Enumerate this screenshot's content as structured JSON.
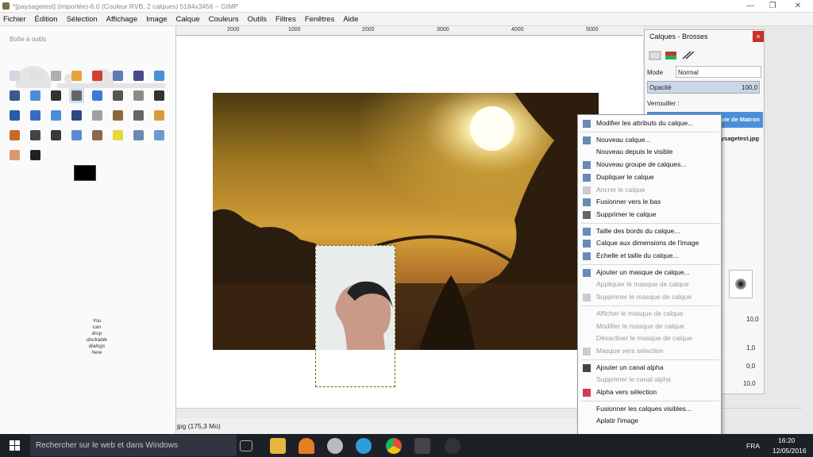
{
  "window": {
    "title": "*[paysagetest] (importée)-6.0 (Couleur RVB, 2 calques) 5184x3456 – GIMP",
    "controls": [
      "—",
      "❐",
      "✕"
    ]
  },
  "menubar": [
    "Fichier",
    "Édition",
    "Sélection",
    "Affichage",
    "Image",
    "Calque",
    "Couleurs",
    "Outils",
    "Filtres",
    "Fenêtres",
    "Aide"
  ],
  "toolbox": {
    "title": "Boîte à outils",
    "drop_hint": [
      "You",
      "can",
      "drop",
      "dockable",
      "dialogs",
      "here"
    ]
  },
  "ruler": {
    "labels": [
      "2000",
      "1000",
      "2000",
      "3000",
      "4000",
      "5000"
    ]
  },
  "status": {
    "text": "jpg (175,3 Mo)"
  },
  "dock": {
    "title": "Calques - Brosses",
    "close": "×",
    "mode_label": "Mode",
    "mode_value": "Normal",
    "opacity_label": "Opacité",
    "opacity_value": "100,0",
    "lock_label": "Verrouiller :",
    "layer1": "pie de Matron",
    "layer2": "ysagetest.jpg",
    "spin_values": [
      "10,0",
      "1,0",
      "0,0",
      "10,0"
    ]
  },
  "context_menu": {
    "items": [
      {
        "label": "Modifier les attributs du calque...",
        "disabled": false,
        "icon": "edit-icon"
      },
      {
        "sep": true
      },
      {
        "label": "Nouveau calque...",
        "disabled": false,
        "icon": "new-layer-icon"
      },
      {
        "label": "Nouveau depuis le visible",
        "disabled": false,
        "icon": ""
      },
      {
        "label": "Nouveau groupe de calques...",
        "disabled": false,
        "icon": "folder-icon"
      },
      {
        "label": "Dupliquer le calque",
        "disabled": false,
        "icon": "duplicate-icon"
      },
      {
        "label": "Ancrer le calque",
        "disabled": true,
        "icon": "anchor-icon"
      },
      {
        "label": "Fusionner vers le bas",
        "disabled": false,
        "icon": "merge-down-icon"
      },
      {
        "label": "Supprimer le calque",
        "disabled": false,
        "icon": "trash-icon"
      },
      {
        "sep": true
      },
      {
        "label": "Taille des bords du calque...",
        "disabled": false,
        "icon": "boundary-icon"
      },
      {
        "label": "Calque aux dimensions de l'image",
        "disabled": false,
        "icon": "fit-icon"
      },
      {
        "label": "Échelle et taille du calque...",
        "disabled": false,
        "icon": "scale-icon"
      },
      {
        "sep": true
      },
      {
        "label": "Ajouter un masque de calque...",
        "disabled": false,
        "icon": "mask-add-icon"
      },
      {
        "label": "Appliquer le masque de calque",
        "disabled": true,
        "icon": ""
      },
      {
        "label": "Supprimer le masque de calque",
        "disabled": true,
        "icon": "trash-icon"
      },
      {
        "sep": true
      },
      {
        "label": "Afficher le masque de calque",
        "disabled": true,
        "icon": ""
      },
      {
        "label": "Modifier le masque de calque",
        "disabled": true,
        "icon": ""
      },
      {
        "label": "Désactiver le masque de calque",
        "disabled": true,
        "icon": ""
      },
      {
        "label": "Masque vers sélection",
        "disabled": true,
        "icon": "mask-select-icon"
      },
      {
        "sep": true
      },
      {
        "label": "Ajouter un canal alpha",
        "disabled": false,
        "icon": "alpha-icon"
      },
      {
        "label": "Supprimer le canal alpha",
        "disabled": true,
        "icon": ""
      },
      {
        "label": "Alpha vers sélection",
        "disabled": false,
        "icon": "alpha-select-icon"
      },
      {
        "sep": true
      },
      {
        "label": "Fusionner les calques visibles...",
        "disabled": false,
        "icon": ""
      },
      {
        "label": "Aplatir l'image",
        "disabled": false,
        "icon": ""
      }
    ]
  },
  "taskbar": {
    "search_placeholder": "Rechercher sur le web et dans Windows",
    "lang": "FRA",
    "time": "16:20",
    "date": "12/05/2016"
  },
  "colors": {
    "accent": "#4a90d9",
    "taskbar": "#1c2128",
    "close_red": "#c9302c"
  }
}
